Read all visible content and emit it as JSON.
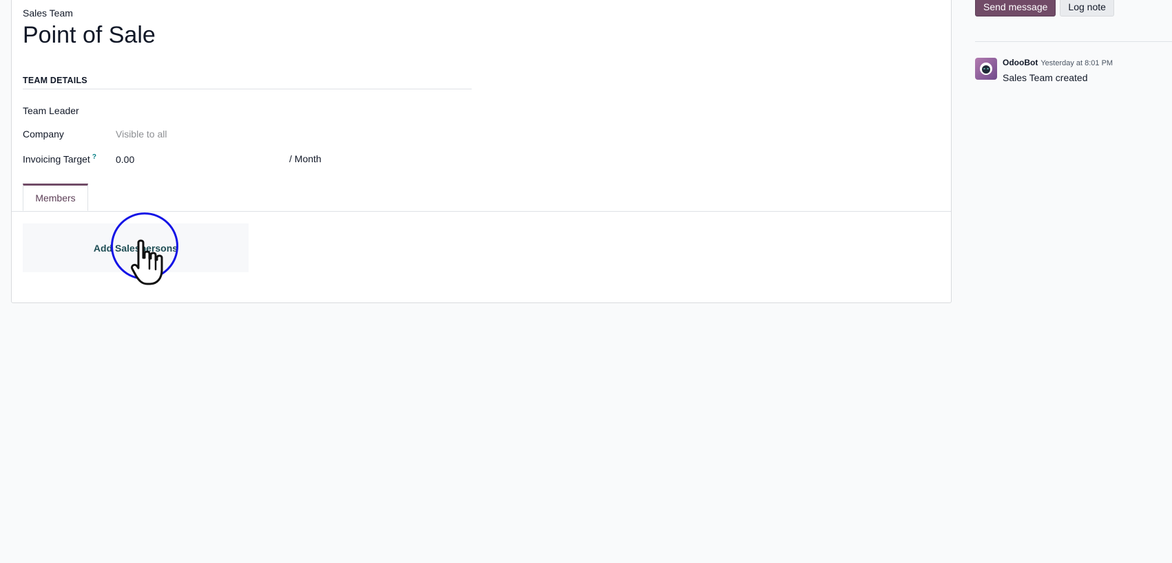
{
  "form": {
    "kicker": "Sales Team",
    "title": "Point of Sale",
    "group_title": "TEAM DETAILS",
    "fields": {
      "team_leader": {
        "label": "Team Leader",
        "value": ""
      },
      "company": {
        "label": "Company",
        "placeholder": "Visible to all"
      },
      "invoicing_target": {
        "label": "Invoicing Target",
        "help": "?",
        "value": "0.00",
        "period": "/ Month"
      }
    },
    "tabs": [
      {
        "label": "Members",
        "active": true
      }
    ],
    "members": {
      "add_button": "Add Salespersons"
    }
  },
  "chatter": {
    "send_message": "Send message",
    "log_note": "Log note",
    "messages": [
      {
        "author": "OdooBot",
        "date": "Yesterday at 8:01 PM",
        "body": "Sales Team created"
      }
    ]
  },
  "colors": {
    "brand": "#714b67",
    "click_ring": "#1414e6",
    "link": "#017e84"
  }
}
